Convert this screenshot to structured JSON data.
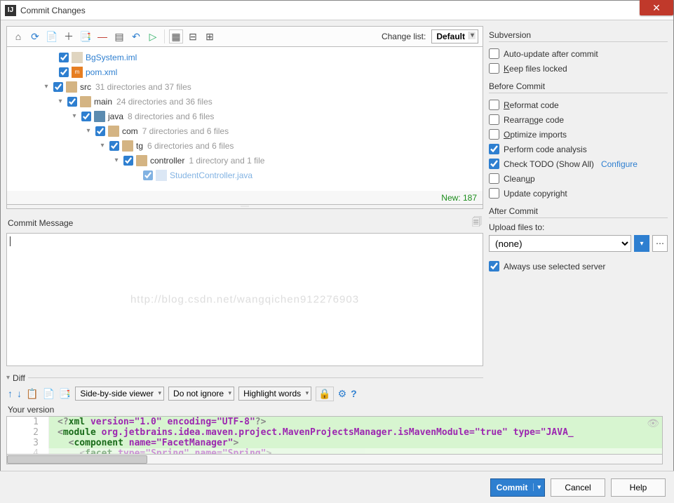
{
  "title": "Commit Changes",
  "changeListLabel": "Change list:",
  "changeList": "Default",
  "tree": {
    "bgsystem": "BgSystem.iml",
    "pom": "pom.xml",
    "src": {
      "name": "src",
      "stats": "31 directories and 37 files"
    },
    "main": {
      "name": "main",
      "stats": "24 directories and 36 files"
    },
    "java": {
      "name": "java",
      "stats": "8 directories and 6 files"
    },
    "com": {
      "name": "com",
      "stats": "7 directories and 6 files"
    },
    "tg": {
      "name": "tg",
      "stats": "6 directories and 6 files"
    },
    "controller": {
      "name": "controller",
      "stats": "1 directory and 1 file"
    },
    "student": "StudentController.java"
  },
  "status": {
    "new": "New: 187"
  },
  "commitMsgLabel": "Commit Message",
  "watermark": "http://blog.csdn.net/wangqichen912276903",
  "diffLabel": "Diff",
  "diffTool": {
    "viewer": "Side-by-side viewer",
    "ignore": "Do not ignore",
    "highlight": "Highlight words"
  },
  "yourVersion": "Your version",
  "code": {
    "l1": {
      "prolog_open": "<?",
      "prolog_name": "xml",
      "attrs": " version=\"1.0\" encoding=\"UTF-8\"",
      "prolog_close": "?>"
    },
    "l2": {
      "open": "<",
      "tag": "module",
      "attrs": " org.jetbrains.idea.maven.project.MavenProjectsManager.isMavenModule=\"true\" type=\"JAVA_"
    },
    "l3": {
      "open": "<",
      "tag": "component",
      "attrs": " name=\"FacetManager\"",
      "close": ">"
    },
    "l4": {
      "open": "<",
      "tag": "facet",
      "attrs": " type=\"Spring\" name=\"Spring\"",
      "close": ">"
    }
  },
  "right": {
    "subversion": {
      "title": "Subversion",
      "autoUpdate": "Auto-update after commit",
      "keepLocked": "Keep files locked"
    },
    "before": {
      "title": "Before Commit",
      "reformat": "Reformat code",
      "rearrange": "Rearrange code",
      "optimize": "Optimize imports",
      "analysis": "Perform code analysis",
      "todo": "Check TODO (Show All)",
      "configure": "Configure",
      "cleanup": "Cleanup",
      "copyright": "Update copyright"
    },
    "after": {
      "title": "After Commit",
      "uploadLabel": "Upload files to:",
      "uploadValue": "(none)",
      "always": "Always use selected server"
    }
  },
  "buttons": {
    "commit": "Commit",
    "cancel": "Cancel",
    "help": "Help"
  }
}
